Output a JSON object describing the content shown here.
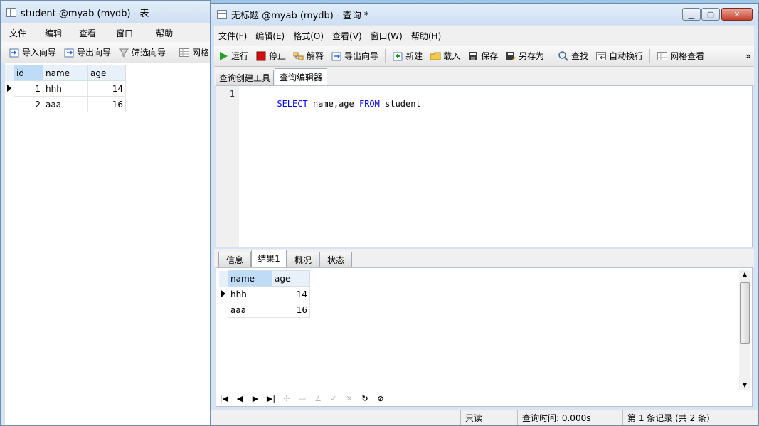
{
  "left_window": {
    "title": "student @myab (mydb) - 表",
    "menu": [
      "文件",
      "编辑",
      "查看",
      "窗口",
      "帮助"
    ],
    "toolbar": {
      "import": "导入向导",
      "export": "导出向导",
      "filter": "筛选向导",
      "grid": "网格"
    },
    "table": {
      "columns": [
        "id",
        "name",
        "age"
      ],
      "rows": [
        {
          "id": "1",
          "name": "hhh",
          "age": "14"
        },
        {
          "id": "2",
          "name": "aaa",
          "age": "16"
        }
      ]
    }
  },
  "right_window": {
    "title": "无标题 @myab (mydb) - 查询 *",
    "menu": [
      "文件(F)",
      "编辑(E)",
      "格式(O)",
      "查看(V)",
      "窗口(W)",
      "帮助(H)"
    ],
    "toolbar": {
      "run": "运行",
      "stop": "停止",
      "explain": "解释",
      "export": "导出向导",
      "new": "新建",
      "load": "载入",
      "save": "保存",
      "save_as": "另存为",
      "find": "查找",
      "wrap": "自动换行",
      "grid_view": "网格查看",
      "more": "»"
    },
    "editor_tabs": [
      "查询创建工具",
      "查询编辑器"
    ],
    "editor": {
      "line_number": "1",
      "kw_select": "SELECT",
      "cols": "name,age",
      "kw_from": "FROM",
      "table": "student"
    },
    "result_tabs": [
      "信息",
      "结果1",
      "概况",
      "状态"
    ],
    "results": {
      "columns": [
        "name",
        "age"
      ],
      "rows": [
        {
          "name": "hhh",
          "age": "14"
        },
        {
          "name": "aaa",
          "age": "16"
        }
      ]
    },
    "status": {
      "readonly": "只读",
      "query_time": "查询时间: 0.000s",
      "records": "第 1 条记录 (共 2 条)"
    }
  },
  "colors": {
    "keyword": "#0000ff",
    "header_selected": "#bfdcf6",
    "run_green": "#2aa02a",
    "stop_red": "#d01010"
  }
}
